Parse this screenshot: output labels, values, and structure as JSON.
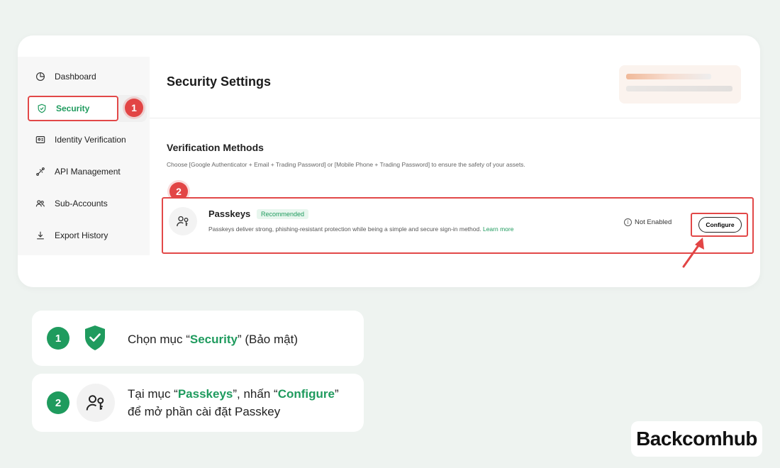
{
  "sidebar": {
    "items": [
      {
        "label": "Dashboard",
        "icon": "pie-chart-icon"
      },
      {
        "label": "Security",
        "icon": "shield-icon"
      },
      {
        "label": "Identity Verification",
        "icon": "id-card-icon"
      },
      {
        "label": "API Management",
        "icon": "api-icon"
      },
      {
        "label": "Sub-Accounts",
        "icon": "users-icon"
      },
      {
        "label": "Export History",
        "icon": "download-icon"
      }
    ],
    "active_item": "Security"
  },
  "markers": {
    "step1": "1",
    "step2": "2"
  },
  "header": {
    "title": "Security Settings"
  },
  "verification": {
    "title": "Verification Methods",
    "description": "Choose [Google Authenticator + Email + Trading Password] or [Mobile Phone + Trading Password] to ensure the safety of your assets."
  },
  "passkeys": {
    "title": "Passkeys",
    "badge": "Recommended",
    "description": "Passkeys deliver strong, phishing-resistant protection while being a simple and secure sign-in method.",
    "link": "Learn more",
    "status": "Not Enabled",
    "button": "Configure"
  },
  "steps": [
    {
      "number": "1",
      "text_before": "Chọn mục “",
      "highlight": "Security",
      "text_after": "” (Bảo mật)"
    },
    {
      "number": "2",
      "text_before": "Tại mục “",
      "highlight": "Passkeys",
      "text_mid": "”, nhấn “",
      "highlight2": "Configure",
      "text_after": "”",
      "line2": "để mở phần cài đặt Passkey"
    }
  ],
  "brand": {
    "logo": "Backcomhub"
  },
  "colors": {
    "accent_green": "#1f9b5e",
    "highlight_red": "#e24848",
    "background": "#eef3f0"
  }
}
